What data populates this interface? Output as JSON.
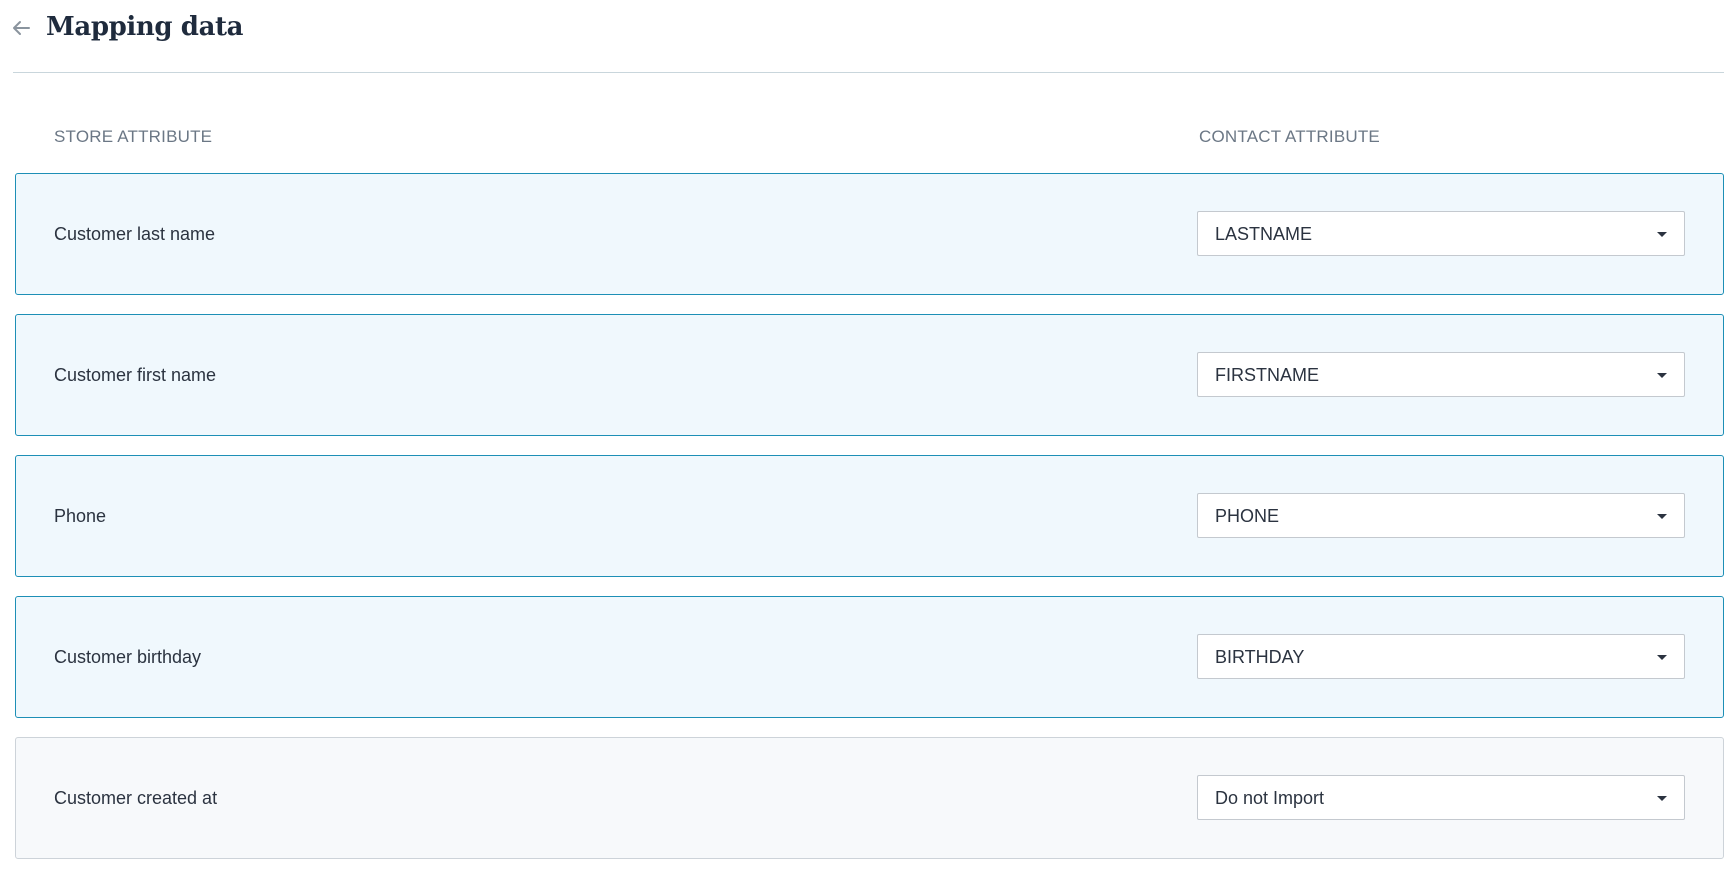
{
  "header": {
    "title": "Mapping data",
    "back_icon": "arrow-left-icon"
  },
  "columns": {
    "store": "STORE ATTRIBUTE",
    "contact": "CONTACT ATTRIBUTE"
  },
  "rows": [
    {
      "label": "Customer last name",
      "value": "LASTNAME"
    },
    {
      "label": "Customer first name",
      "value": "FIRSTNAME"
    },
    {
      "label": "Phone",
      "value": "PHONE"
    },
    {
      "label": "Customer birthday",
      "value": "BIRTHDAY"
    },
    {
      "label": "Customer created at",
      "value": "Do not Import"
    }
  ],
  "colors": {
    "active_border": "#1d8fb6",
    "active_bg": "#f0f8fd",
    "inactive_border": "#cdd3d9",
    "inactive_bg": "#f7f9fb"
  }
}
